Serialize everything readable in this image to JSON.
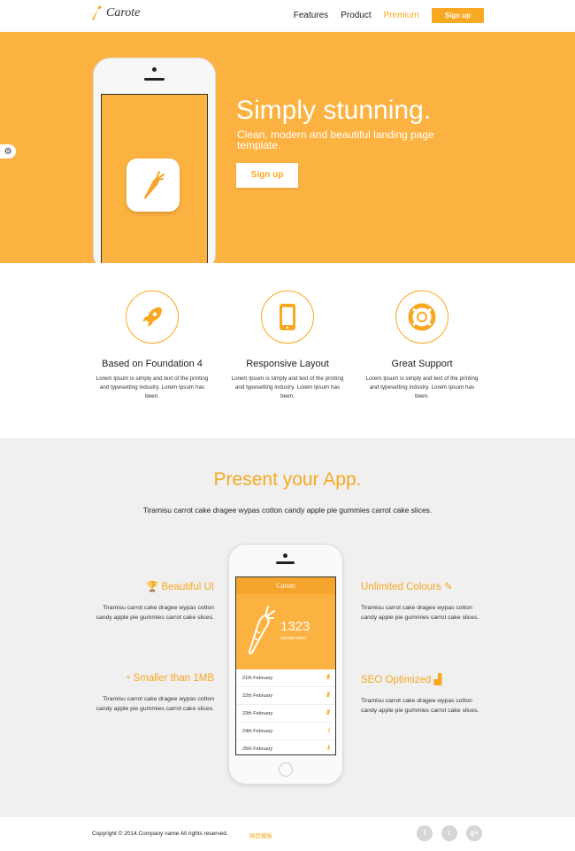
{
  "brand": {
    "name": "Carote"
  },
  "nav": {
    "items": [
      "Features",
      "Product",
      "Premium"
    ],
    "signup": "Sign up"
  },
  "hero": {
    "title": "Simply stunning.",
    "subtitle": "Clean, modern and beautiful landing page template.",
    "cta": "Sign up"
  },
  "features": [
    {
      "icon": "rocket-icon",
      "title": "Based on Foundation 4",
      "text": "Lorem Ipsum is simply and text of the printing and typesetting industry. Lorem Ipsum has been."
    },
    {
      "icon": "mobile-icon",
      "title": "Responsive Layout",
      "text": "Lorem Ipsum is simply and text of the printing and typesetting industry. Lorem Ipsum has been."
    },
    {
      "icon": "lifebuoy-icon",
      "title": "Great Support",
      "text": "Lorem Ipsum is simply and text of the printing and typesetting industry. Lorem Ipsum has been."
    }
  ],
  "present": {
    "title": "Present your App.",
    "subtitle": "Tiramisu carrot cake dragee wypas cotton candy apple pie gummies carrot cake slices.",
    "left": [
      {
        "title": "Beautiful UI",
        "icon": "trophy-icon",
        "text": "Tiramisu carrot cake dragee wypas cotton candy apple pie gummies carrot cake slices."
      },
      {
        "title": "Smaller than 1MB",
        "icon": "gauge-icon",
        "text": "Tiramisu carrot cake dragee wypas cotton candy apple pie gummies carrot cake slices."
      }
    ],
    "right": [
      {
        "title": "Unlimited Colours",
        "icon": "pencil-icon",
        "text": "Tiramisu carrot cake dragee wypas cotton candy apple pie gummies carrot cake slices."
      },
      {
        "title": "SEO Optimized",
        "icon": "bars-icon",
        "text": "Tiramisu carrot cake dragee wypas cotton candy apple pie gummies carrot cake slices."
      }
    ]
  },
  "app": {
    "name": "Carote",
    "count": "1323",
    "count_label": "carrots eaten",
    "rows": [
      {
        "date": "21th February",
        "marks": "///"
      },
      {
        "date": "22th February",
        "marks": "///"
      },
      {
        "date": "23th February",
        "marks": "///"
      },
      {
        "date": "24th February",
        "marks": "/"
      },
      {
        "date": "25th February",
        "marks": "//"
      }
    ]
  },
  "footer": {
    "copyright": "Copyright © 2014.Company name All rights reserved.",
    "link": "网页模板",
    "socials": [
      "f",
      "t",
      "g+"
    ]
  },
  "colors": {
    "accent": "#f8a821",
    "hero_bg": "#fcb240",
    "section_gray": "#f0f0f0"
  }
}
